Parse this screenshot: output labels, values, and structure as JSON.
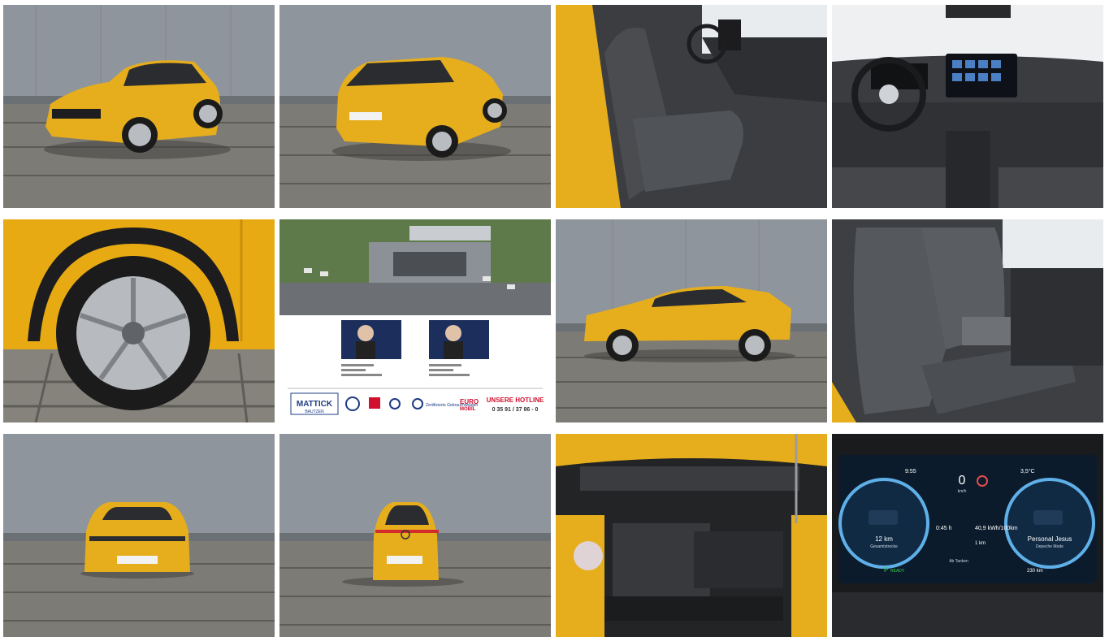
{
  "gallery": {
    "photos": [
      {
        "name": "front-three-quarter"
      },
      {
        "name": "rear-three-quarter"
      },
      {
        "name": "front-seats-interior"
      },
      {
        "name": "dashboard-interior"
      },
      {
        "name": "wheel-detail"
      },
      {
        "name": "dealer-info"
      },
      {
        "name": "side-profile"
      },
      {
        "name": "rear-seats-interior"
      },
      {
        "name": "front-view"
      },
      {
        "name": "rear-view"
      },
      {
        "name": "engine-bay"
      },
      {
        "name": "digital-cockpit"
      }
    ]
  },
  "dealer": {
    "hotline_title": "UNSERE HOTLINE",
    "hotline_number": "0 35 91 / 37 86 - 0",
    "brand": "MATTICK",
    "city": "BAUTZEN",
    "euro_label": "EURO",
    "mobil_label": "MOBIL",
    "certified_label": "Zertifizierte Gebrauchtwagen"
  },
  "cockpit": {
    "time": "9:55",
    "outside_temp": "3,5°C",
    "speed": "0",
    "speed_unit": "km/h",
    "trip_distance": "12 km",
    "trip_label": "Gesamtstrecke",
    "trip_time": "0:45 h",
    "consumption": "40,9 kWh/100km",
    "trip_count": "1 km",
    "song_title": "Personal Jesus",
    "song_artist": "Depeche Mode",
    "range": "230 km",
    "ready_label": "READY",
    "gear": "P",
    "destination": "Ab Tanken"
  }
}
